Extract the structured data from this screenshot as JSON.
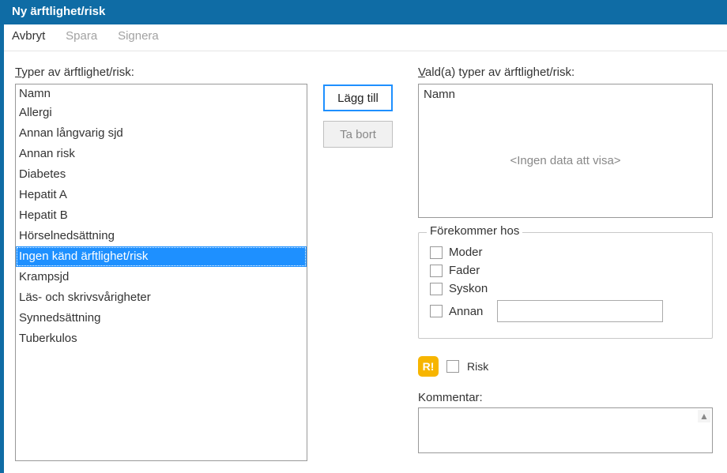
{
  "window": {
    "title": "Ny ärftlighet/risk"
  },
  "menu": {
    "cancel": "Avbryt",
    "save": "Spara",
    "sign": "Signera"
  },
  "left": {
    "label_prefix": "T",
    "label_rest": "yper av ärftlighet/risk:",
    "header": "Namn",
    "items": [
      "Allergi",
      "Annan långvarig sjd",
      "Annan risk",
      "Diabetes",
      "Hepatit A",
      "Hepatit B",
      "Hörselnedsättning",
      "Ingen känd ärftlighet/risk",
      "Krampsjd",
      "Läs- och skrivsvårigheter",
      "Synnedsättning",
      "Tuberkulos"
    ],
    "selected_index": 7
  },
  "buttons": {
    "add": "Lägg till",
    "remove": "Ta bort"
  },
  "right": {
    "label_prefix": "V",
    "label_rest": "ald(a) typer av ärftlighet/risk:",
    "header": "Namn",
    "empty": "<Ingen data att visa>"
  },
  "occurs": {
    "title": "Förekommer hos",
    "mother": "Moder",
    "father": "Fader",
    "sibling": "Syskon",
    "other": "Annan",
    "other_value": ""
  },
  "risk": {
    "badge": "R!",
    "label": "Risk"
  },
  "comment": {
    "label_prefix": "K",
    "label_rest": "ommentar:",
    "value": ""
  }
}
